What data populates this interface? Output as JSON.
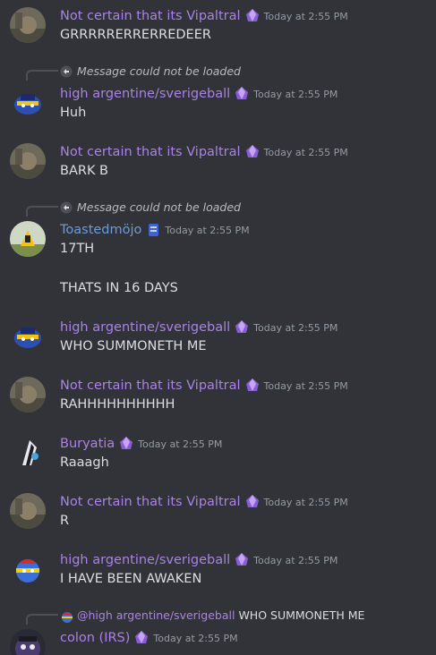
{
  "messages": [
    {
      "author": "Not certain that its Vipaltral",
      "time": "Today at 2:55 PM",
      "lines": [
        "GRRRRRERRERREDEER"
      ]
    },
    {
      "reply": "Message could not be loaded",
      "author": "high argentine/sverigeball",
      "time": "Today at 2:55 PM",
      "lines": [
        "Huh"
      ]
    },
    {
      "author": "Not certain that its Vipaltral",
      "time": "Today at 2:55 PM",
      "lines": [
        "BARK B"
      ]
    },
    {
      "reply": "Message could not be loaded",
      "author": "Toastedmöjo",
      "time": "Today at 2:55 PM",
      "lines": [
        "17TH",
        "THATS IN 16 DAYS"
      ]
    },
    {
      "author": "high argentine/sverigeball",
      "time": "Today at 2:55 PM",
      "lines": [
        "WHO SUMMONETH ME"
      ]
    },
    {
      "author": "Not certain that its Vipaltral",
      "time": "Today at 2:55 PM",
      "lines": [
        "RAHHHHHHHHHH"
      ]
    },
    {
      "author": "Buryatia",
      "time": "Today at 2:55 PM",
      "lines": [
        "Raaagh"
      ]
    },
    {
      "author": "Not certain that its Vipaltral",
      "time": "Today at 2:55 PM",
      "lines": [
        "R"
      ]
    },
    {
      "author": "high argentine/sverigeball",
      "time": "Today at 2:55 PM",
      "lines": [
        "I HAVE BEEN AWAKEN"
      ]
    },
    {
      "reply_user": "@high argentine/sverigeball",
      "reply_content": "WHO SUMMONETH ME",
      "author": "colon (IRS)",
      "time": "Today at 2:55 PM",
      "lines": []
    }
  ],
  "colors": {
    "background": "#313338",
    "username_purple": "#a982e6",
    "username_blue": "#6b9bd8",
    "timestamp": "#949ba4",
    "text": "#dbdee1"
  },
  "icons": {
    "nitro_badge": "nitro-crystal-icon",
    "blue_badge": "blue-card-icon",
    "reply": "reply-arrow-icon"
  }
}
